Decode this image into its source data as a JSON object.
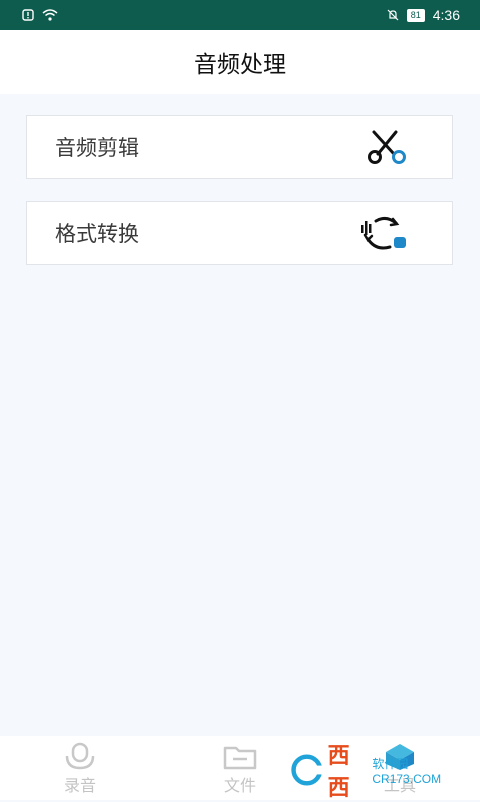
{
  "status_bar": {
    "time": "4:36",
    "battery": "81"
  },
  "header": {
    "title": "音频处理"
  },
  "menu": [
    {
      "label": "音频剪辑",
      "icon": "scissors-icon"
    },
    {
      "label": "格式转换",
      "icon": "convert-icon"
    }
  ],
  "bottom_nav": [
    {
      "label": "录音",
      "icon": "microphone-icon"
    },
    {
      "label": "文件",
      "icon": "folder-icon"
    },
    {
      "label": "工具",
      "icon": "toolbox-icon"
    }
  ],
  "watermark": {
    "main": "西西",
    "sub": "软件园 CR173.COM"
  },
  "colors": {
    "status_bar": "#0d5c4d",
    "accent": "#1e88c8",
    "background": "#f5f9fd"
  }
}
